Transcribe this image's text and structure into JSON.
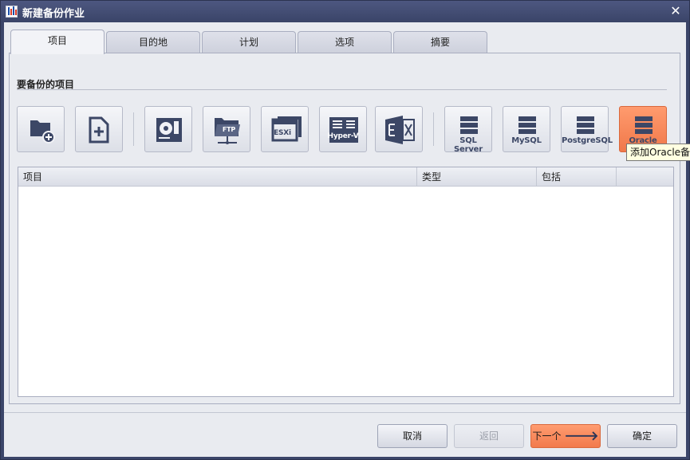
{
  "window": {
    "title": "新建备份作业",
    "close_symbol": "✕"
  },
  "tabs": [
    {
      "label": "项目",
      "active": true
    },
    {
      "label": "目的地",
      "active": false
    },
    {
      "label": "计划",
      "active": false
    },
    {
      "label": "选项",
      "active": false
    },
    {
      "label": "摘要",
      "active": false
    }
  ],
  "section": {
    "title": "要备份的项目"
  },
  "toolbar": {
    "buttons": [
      {
        "name": "add-folder",
        "icon": "folder-plus-icon",
        "label": ""
      },
      {
        "name": "add-file",
        "icon": "file-plus-icon",
        "label": ""
      },
      {
        "name": "disk-image",
        "icon": "hard-disk-icon",
        "label": ""
      },
      {
        "name": "ftp",
        "icon": "ftp-folder-icon",
        "label": "FTP"
      },
      {
        "name": "esxi",
        "icon": "esxi-window-icon",
        "label": "ESXi"
      },
      {
        "name": "hyper-v",
        "icon": "hyper-v-icon",
        "label": "Hyper-V"
      },
      {
        "name": "exchange",
        "icon": "exchange-icon",
        "label": ""
      },
      {
        "name": "sql-server",
        "icon": "database-icon",
        "label": "SQL Server"
      },
      {
        "name": "mysql",
        "icon": "database-icon",
        "label": "MySQL"
      },
      {
        "name": "postgresql",
        "icon": "database-icon",
        "label": "PostgreSQL"
      },
      {
        "name": "oracle",
        "icon": "database-icon",
        "label": "Oracle"
      }
    ]
  },
  "table": {
    "columns": [
      "项目",
      "类型",
      "包括"
    ],
    "rows": []
  },
  "tooltip": {
    "text": "添加Oracle备"
  },
  "footer": {
    "cancel": "取消",
    "back": "返回",
    "next": "下一个",
    "ok": "确定"
  },
  "colors": {
    "accent": "#f27a4c",
    "titlebar": "#3a4468",
    "icon": "#3c4766"
  }
}
